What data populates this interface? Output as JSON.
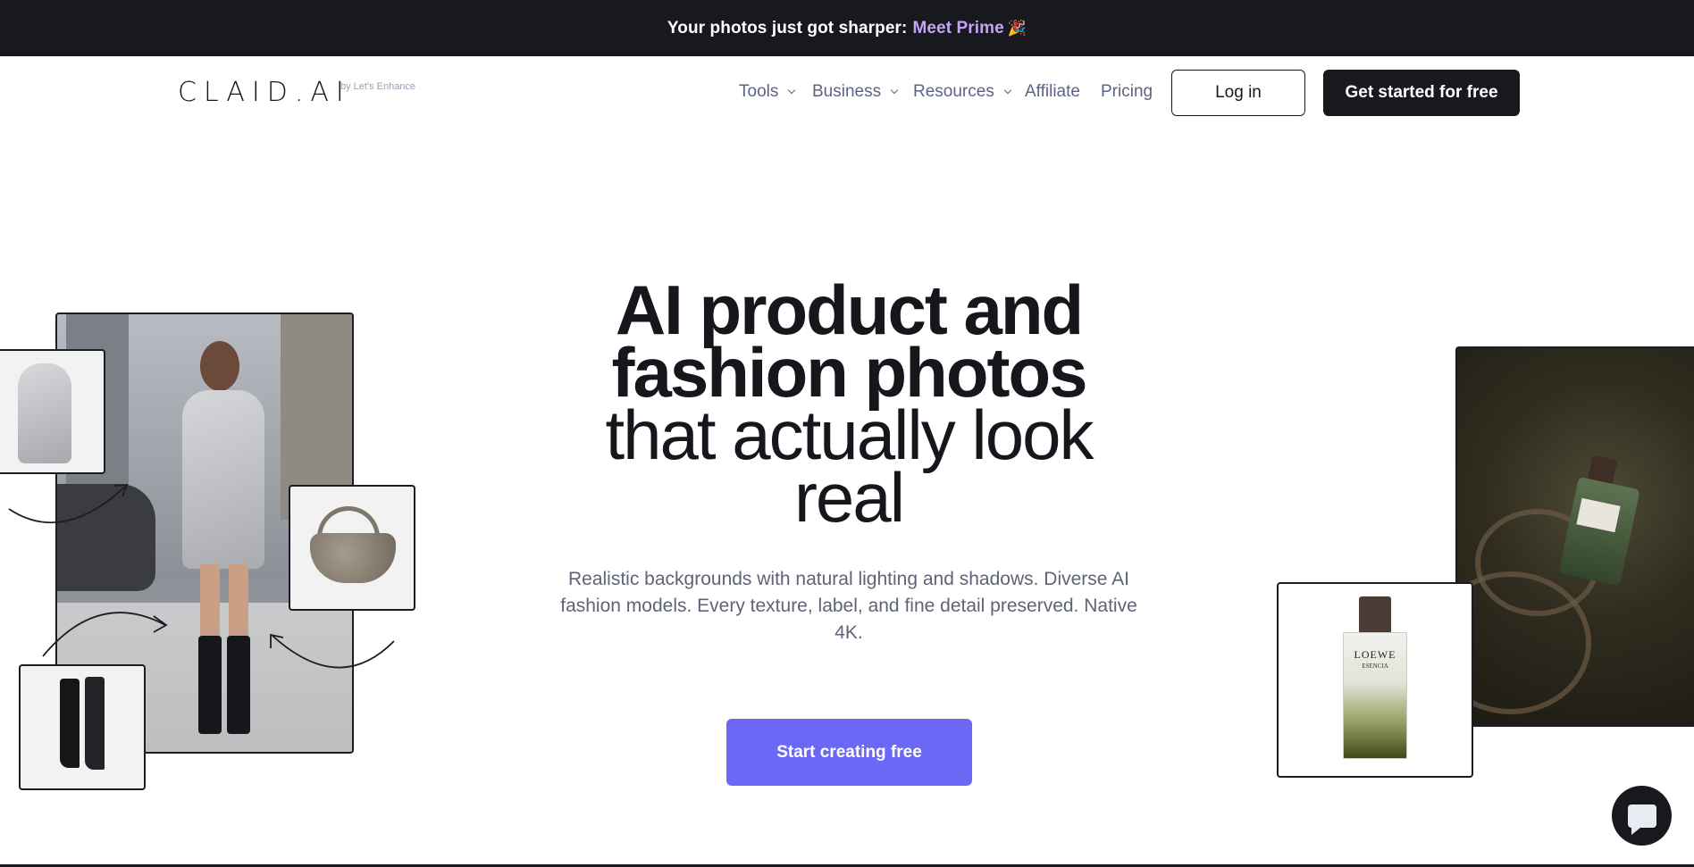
{
  "announcement": {
    "text": "Your photos just got sharper:",
    "link": "Meet Prime",
    "emoji": "🎉"
  },
  "logo": {
    "name": "CLAID.AI",
    "sub": "by Let's Enhance"
  },
  "nav": {
    "items": [
      {
        "label": "Tools",
        "dropdown": true
      },
      {
        "label": "Business",
        "dropdown": true
      },
      {
        "label": "Resources",
        "dropdown": true
      },
      {
        "label": "Affiliate",
        "dropdown": false
      },
      {
        "label": "Pricing",
        "dropdown": false
      }
    ],
    "login": "Log in",
    "get_started": "Get started for free"
  },
  "hero": {
    "title_bold_1": "AI product and",
    "title_bold_2": "fashion photos",
    "title_light_1": "that actually look",
    "title_light_2": "real",
    "subtitle": "Realistic backgrounds with natural lighting and shadows. Diverse AI fashion models. Every texture, label, and fine detail preserved. Native 4K.",
    "cta": "Start creating free"
  },
  "perfume": {
    "brand": "LOEWE",
    "sub": "ESENCIA"
  },
  "colors": {
    "accent": "#6b68f5",
    "dark": "#18191f",
    "link": "#c6a4f5"
  }
}
